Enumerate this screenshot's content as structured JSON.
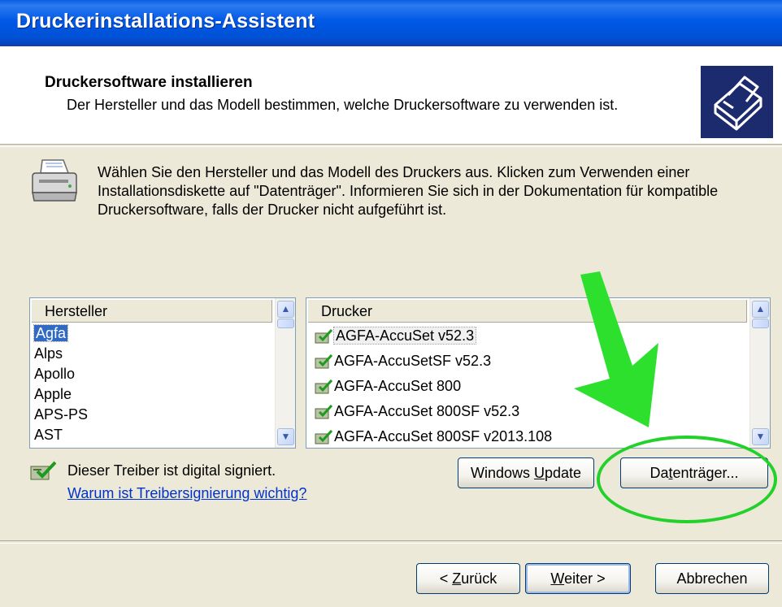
{
  "window": {
    "title": "Druckerinstallations-Assistent"
  },
  "header": {
    "title": "Druckersoftware installieren",
    "subtitle": "Der Hersteller und das Modell bestimmen, welche Druckersoftware zu verwenden ist."
  },
  "instructions": "Wählen Sie den Hersteller und das Modell des Druckers aus. Klicken zum Verwenden einer Installationsdiskette auf \"Datenträger\". Informieren Sie sich in der Dokumentation für kompatible Druckersoftware, falls der Drucker nicht aufgeführt ist.",
  "manufacturers": {
    "header": "Hersteller",
    "items": [
      "Agfa",
      "Alps",
      "Apollo",
      "Apple",
      "APS-PS",
      "AST"
    ],
    "selected": "Agfa"
  },
  "printers": {
    "header": "Drucker",
    "items": [
      "AGFA-AccuSet v52.3",
      "AGFA-AccuSetSF v52.3",
      "AGFA-AccuSet 800",
      "AGFA-AccuSet 800SF v52.3",
      "AGFA-AccuSet 800SF v2013.108"
    ],
    "selected": "AGFA-AccuSet v52.3"
  },
  "signing": {
    "text": "Dieser Treiber ist digital signiert.",
    "link": "Warum ist Treibersignierung wichtig?"
  },
  "buttons": {
    "windows_update_pre": "Windows ",
    "windows_update_u": "U",
    "windows_update_post": "pdate",
    "disk_pre": "Da",
    "disk_u": "t",
    "disk_post": "enträger...",
    "back_pre": "< ",
    "back_u": "Z",
    "back_post": "urück",
    "next_u": "W",
    "next_post": "eiter >",
    "cancel": "Abbrechen"
  },
  "colors": {
    "titlebar": "#0058e6",
    "selection": "#316ac5",
    "annotation": "#22d12a",
    "link": "#0033cc"
  }
}
